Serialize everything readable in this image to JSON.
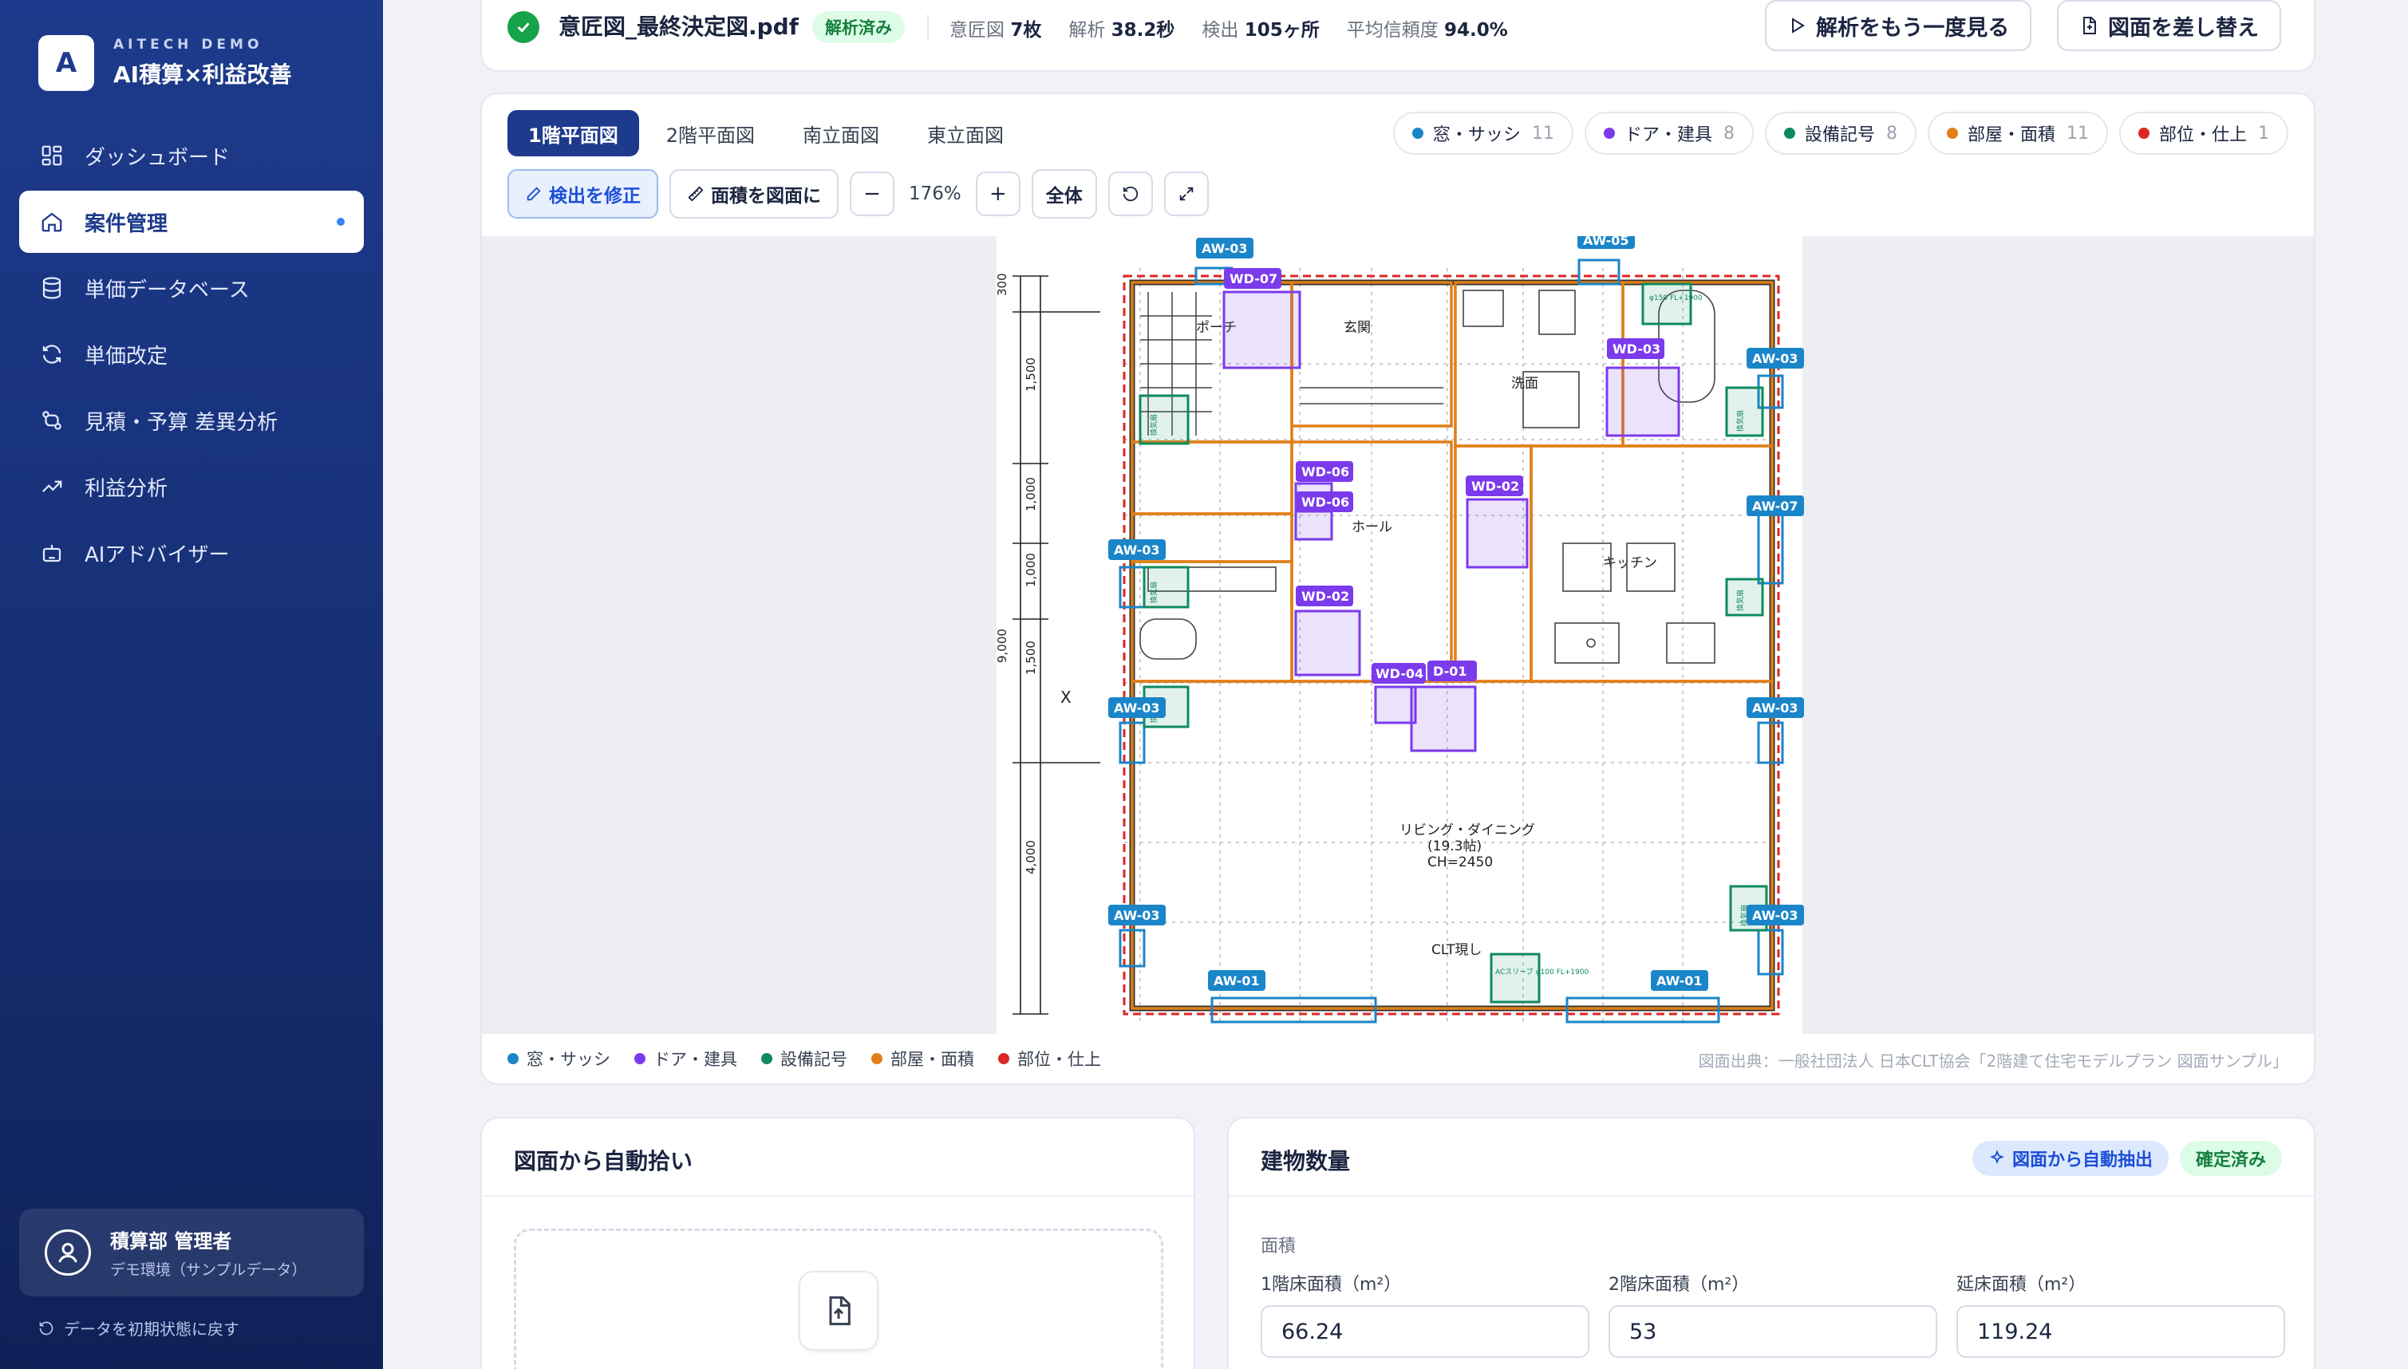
{
  "brand": {
    "subtitle": "AITECH DEMO",
    "title": "AI積算×利益改善",
    "logo_letter": "A"
  },
  "nav": [
    {
      "label": "ダッシュボード",
      "icon": "dashboard-icon"
    },
    {
      "label": "案件管理",
      "icon": "home-icon",
      "active": true
    },
    {
      "label": "単価データベース",
      "icon": "database-icon"
    },
    {
      "label": "単価改定",
      "icon": "refresh-icon"
    },
    {
      "label": "見積・予算 差異分析",
      "icon": "compare-icon"
    },
    {
      "label": "利益分析",
      "icon": "trend-icon"
    },
    {
      "label": "AIアドバイザー",
      "icon": "robot-icon"
    }
  ],
  "user": {
    "name": "積算部 管理者",
    "env": "デモ環境（サンプルデータ）"
  },
  "reset_label": "データを初期状態に戻す",
  "file": {
    "name": "意匠図_最終決定図.pdf",
    "status": "解析済み",
    "stats": [
      {
        "label": "意匠図",
        "value": "7枚"
      },
      {
        "label": "解析",
        "value": "38.2秒"
      },
      {
        "label": "検出",
        "value": "105ヶ所"
      },
      {
        "label": "平均信頼度",
        "value": "94.0%"
      }
    ],
    "btn_review": "解析をもう一度見る",
    "btn_replace": "図面を差し替え"
  },
  "viewer": {
    "tabs": [
      "1階平面図",
      "2階平面図",
      "南立面図",
      "東立面図"
    ],
    "chips": [
      {
        "label": "窓・サッシ",
        "count": "11",
        "color": "#1a85c8"
      },
      {
        "label": "ドア・建具",
        "count": "8",
        "color": "#7c3aed"
      },
      {
        "label": "設備記号",
        "count": "8",
        "color": "#0f8a5f"
      },
      {
        "label": "部屋・面積",
        "count": "11",
        "color": "#e07f16"
      },
      {
        "label": "部位・仕上",
        "count": "1",
        "color": "#dc2626"
      }
    ],
    "tool_edit": "検出を修正",
    "tool_area": "面積を図面に",
    "zoom": "176%",
    "tool_fit": "全体",
    "legend": [
      "窓・サッシ",
      "ドア・建具",
      "設備記号",
      "部屋・面積",
      "部位・仕上"
    ],
    "credit": "図面出典：一般社団法人 日本CLT協会「2階建て住宅モデルプラン 図面サンプル」",
    "plan": {
      "rooms": [
        "ポーチ",
        "玄関",
        "洗面",
        "ホール",
        "キッチン",
        "リビング・ダイニング",
        "(19.3帖)",
        "CH=2450",
        "CLT現し"
      ],
      "dims": [
        "300",
        "1,500",
        "1,000",
        "1,000",
        "1,500",
        "4,000",
        "9,000"
      ],
      "windows": [
        "AW-03",
        "AW-05",
        "AW-03",
        "AW-07",
        "AW-03",
        "AW-03",
        "AW-03",
        "AW-03",
        "AW-03",
        "AW-01",
        "AW-01"
      ],
      "doors": [
        "WD-07",
        "WD-03",
        "WD-06",
        "WD-06",
        "WD-02",
        "WD-02",
        "WD-04",
        "D-01"
      ],
      "equip": [
        "φ150 FL+1900",
        "換気扇",
        "換気扇",
        "換気扇",
        "換気扇",
        "換気扇",
        "ACスリーブ φ100 FL+1900",
        "換気扇"
      ]
    }
  },
  "pick": {
    "title": "図面から自動拾い"
  },
  "qty": {
    "title": "建物数量",
    "badge_auto": "図面から自動抽出",
    "badge_done": "確定済み",
    "section": "面積",
    "fields": [
      {
        "label": "1階床面積（m²）",
        "value": "66.24"
      },
      {
        "label": "2階床面積（m²）",
        "value": "53"
      },
      {
        "label": "延床面積（m²）",
        "value": "119.24"
      }
    ]
  }
}
